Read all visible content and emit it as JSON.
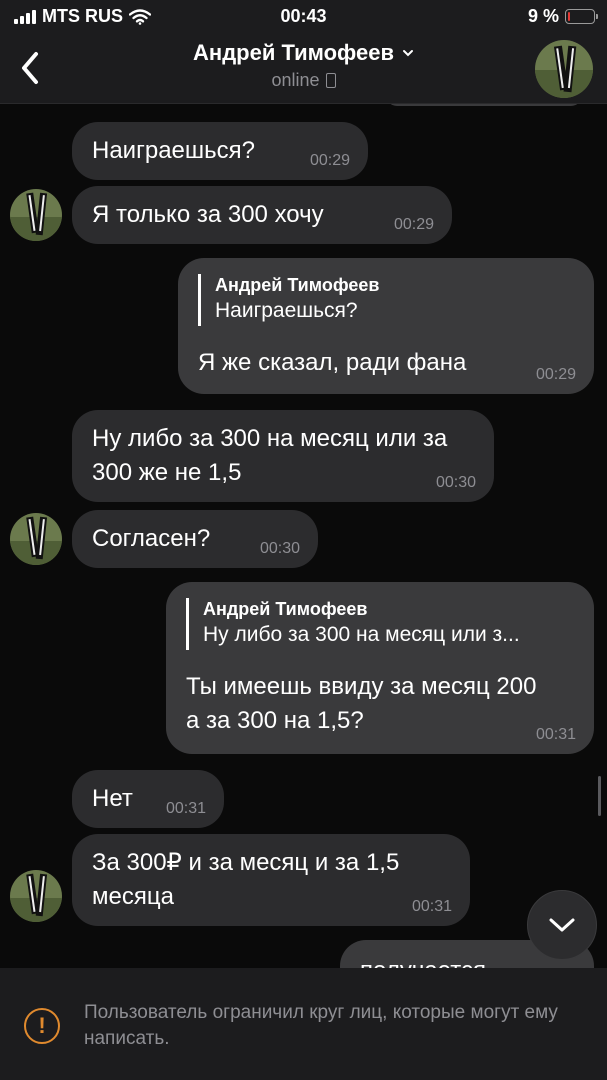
{
  "status_bar": {
    "carrier": "MTS RUS",
    "time": "00:43",
    "battery": "9 %",
    "battery_level": 0.09
  },
  "header": {
    "contact_name": "Андрей Тимофеев",
    "status": "online"
  },
  "messages": [
    {
      "text": "Наиграешься?",
      "time": "00:29",
      "direction": "in"
    },
    {
      "text": "Я только за 300 хочу",
      "time": "00:29",
      "direction": "in"
    },
    {
      "reply_author": "Андрей Тимофеев",
      "reply_text": "Наиграешься?",
      "text": "Я же сказал, ради фана",
      "time": "00:29",
      "direction": "out"
    },
    {
      "text": "Ну либо за 300 на месяц или за 300 же не 1,5",
      "time": "00:30",
      "direction": "in"
    },
    {
      "text": "Согласен?",
      "time": "00:30",
      "direction": "in"
    },
    {
      "reply_author": "Андрей Тимофеев",
      "reply_text": "Ну либо за 300 на месяц или з...",
      "text": "Ты имеешь ввиду за месяц 200 а за 300 на 1,5?",
      "time": "00:31",
      "direction": "out"
    },
    {
      "text": "Нет",
      "time": "00:31",
      "direction": "in"
    },
    {
      "text": "За 300₽ и за месяц и за 1,5 месяца",
      "time": "00:31",
      "direction": "in"
    },
    {
      "text": "получается",
      "direction": "out"
    }
  ],
  "footer": {
    "notice": "Пользователь ограничил круг лиц, которые могут ему написать."
  },
  "icons": {
    "back": "chevron-left-icon",
    "dropdown": "chevron-down-icon",
    "device": "phone-icon",
    "scroll_down": "chevron-down-icon",
    "warning": "exclamation-circle-icon"
  },
  "colors": {
    "background": "#0a0a0a",
    "bar": "#1c1c1e",
    "bubble_in": "#2c2c2e",
    "bubble_out": "#3a3a3c",
    "warning": "#e08a2e",
    "battery_low": "#e53935"
  }
}
